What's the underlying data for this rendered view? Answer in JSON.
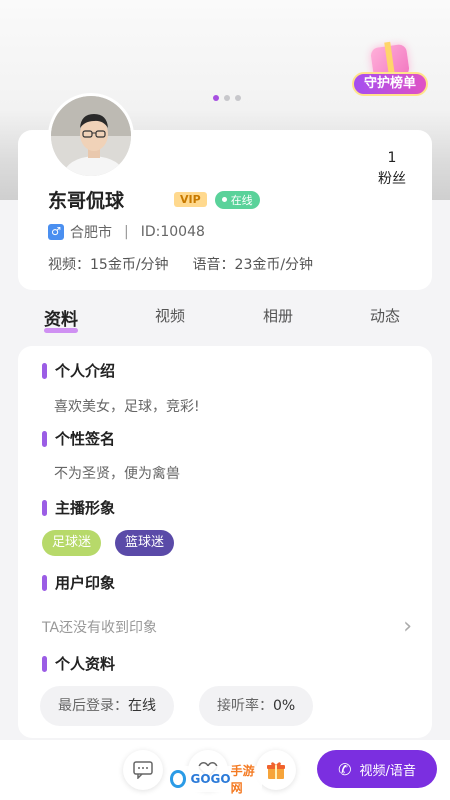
{
  "carousel": {
    "count": 3,
    "active": 0
  },
  "guard_badge": {
    "label": "守护榜单"
  },
  "profile": {
    "name": "东哥侃球",
    "vip": "VIP",
    "online": "在线",
    "fans_count": "1",
    "fans_label": "粉丝",
    "gender": "♂",
    "city": "合肥市",
    "id_text": "ID:10048",
    "video_price": "视频：15金币/分钟",
    "voice_price": "语音：23金币/分钟"
  },
  "tabs": [
    {
      "label": "资料",
      "active": true
    },
    {
      "label": "视频",
      "active": false
    },
    {
      "label": "相册",
      "active": false
    },
    {
      "label": "动态",
      "active": false
    }
  ],
  "sections": {
    "intro_title": "个人介绍",
    "intro_text": "喜欢美女，足球，竞彩!",
    "signature_title": "个性签名",
    "signature_text": "不为圣贤，便为禽兽",
    "image_title": "主播形象",
    "tags": [
      "足球迷",
      "篮球迷"
    ],
    "impression_title": "用户印象",
    "impression_text": "TA还没有收到印象",
    "personal_title": "个人资料",
    "last_login_key": "最后登录：",
    "last_login_val": "在线",
    "answer_rate_key": "接听率：",
    "answer_rate_val": "0%"
  },
  "bottom_bar": {
    "call_label": "视频/语音"
  },
  "watermark": {
    "text_a": "GO",
    "text_b": "GO",
    "text_c": "手游网"
  },
  "colors": {
    "accent": "#9b5de5",
    "call_button": "#7b2fe0",
    "online": "#5ad29a",
    "vip_bg": "#ffd98e"
  }
}
